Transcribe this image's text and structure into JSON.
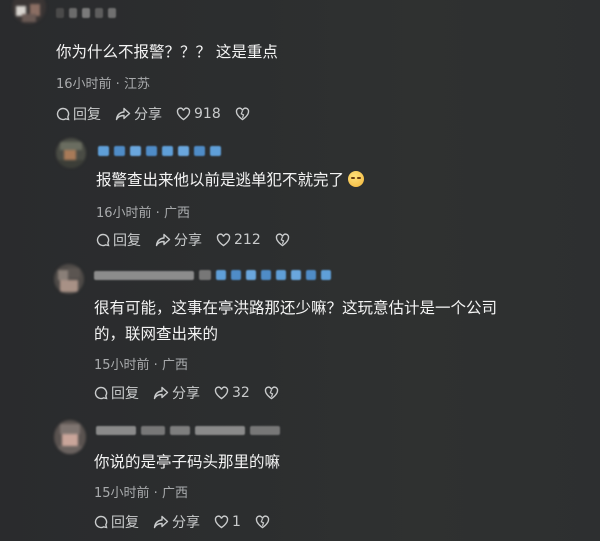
{
  "comments": [
    {
      "text": "你为什么不报警？？？ 这是重点",
      "meta": "16小时前 · 江苏",
      "reply_label": "回复",
      "share_label": "分享",
      "likes": "918"
    },
    {
      "text": "报警查出来他以前是逃单犯不就完了",
      "meta": "16小时前 · 广西",
      "reply_label": "回复",
      "share_label": "分享",
      "likes": "212"
    },
    {
      "text_line1": "很有可能，这事在亭洪路那还少嘛？这玩意估计是一个公司",
      "text_line2": "的，联网查出来的",
      "meta": "15小时前 · 广西",
      "reply_label": "回复",
      "share_label": "分享",
      "likes": "32"
    },
    {
      "text": "你说的是亭子码头那里的嘛",
      "meta": "15小时前 · 广西",
      "reply_label": "回复",
      "share_label": "分享",
      "likes": "1"
    }
  ],
  "icons": {
    "reply": "reply-bubble-icon",
    "share": "share-arrow-icon",
    "like": "heart-icon",
    "dislike": "broken-heart-icon"
  },
  "colors": {
    "background": "#2c2e2f",
    "text": "#f4f4f4",
    "meta": "#a9abad",
    "username_blue": "#5f9fd8"
  }
}
